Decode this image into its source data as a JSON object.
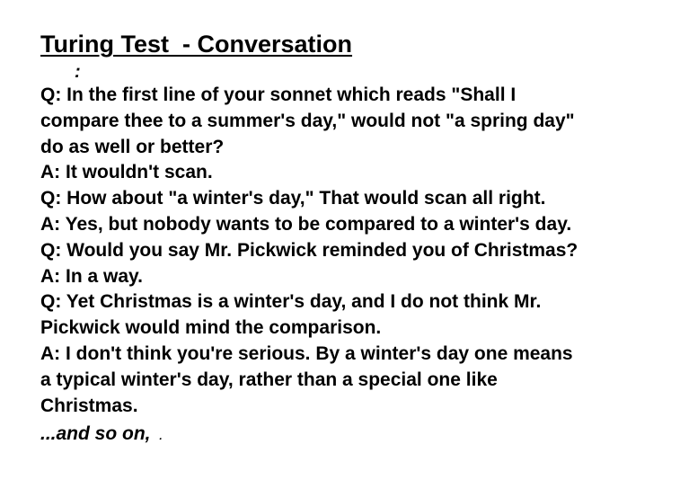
{
  "title": "Turing Test  - Conversation",
  "colon": ":",
  "dialogue": [
    "Q: In the first line of your sonnet which reads \"Shall I",
    "compare thee to a summer's day,\" would not \"a spring day\"",
    "do as well or better?",
    "A: It wouldn't scan.",
    "Q: How about \"a winter's day,\" That would scan all right.",
    "A: Yes, but nobody wants to be compared to a winter's day.",
    "Q: Would you say Mr. Pickwick reminded you of Christmas?",
    "A: In a way.",
    "Q: Yet Christmas is a winter's day, and I do not think Mr.",
    "Pickwick would mind the comparison.",
    "A: I don't think you're serious. By a winter's day one means",
    "a typical winter's day, rather than a special one like",
    "Christmas."
  ],
  "ending": {
    "text": "...and so on,",
    "dot": "."
  }
}
